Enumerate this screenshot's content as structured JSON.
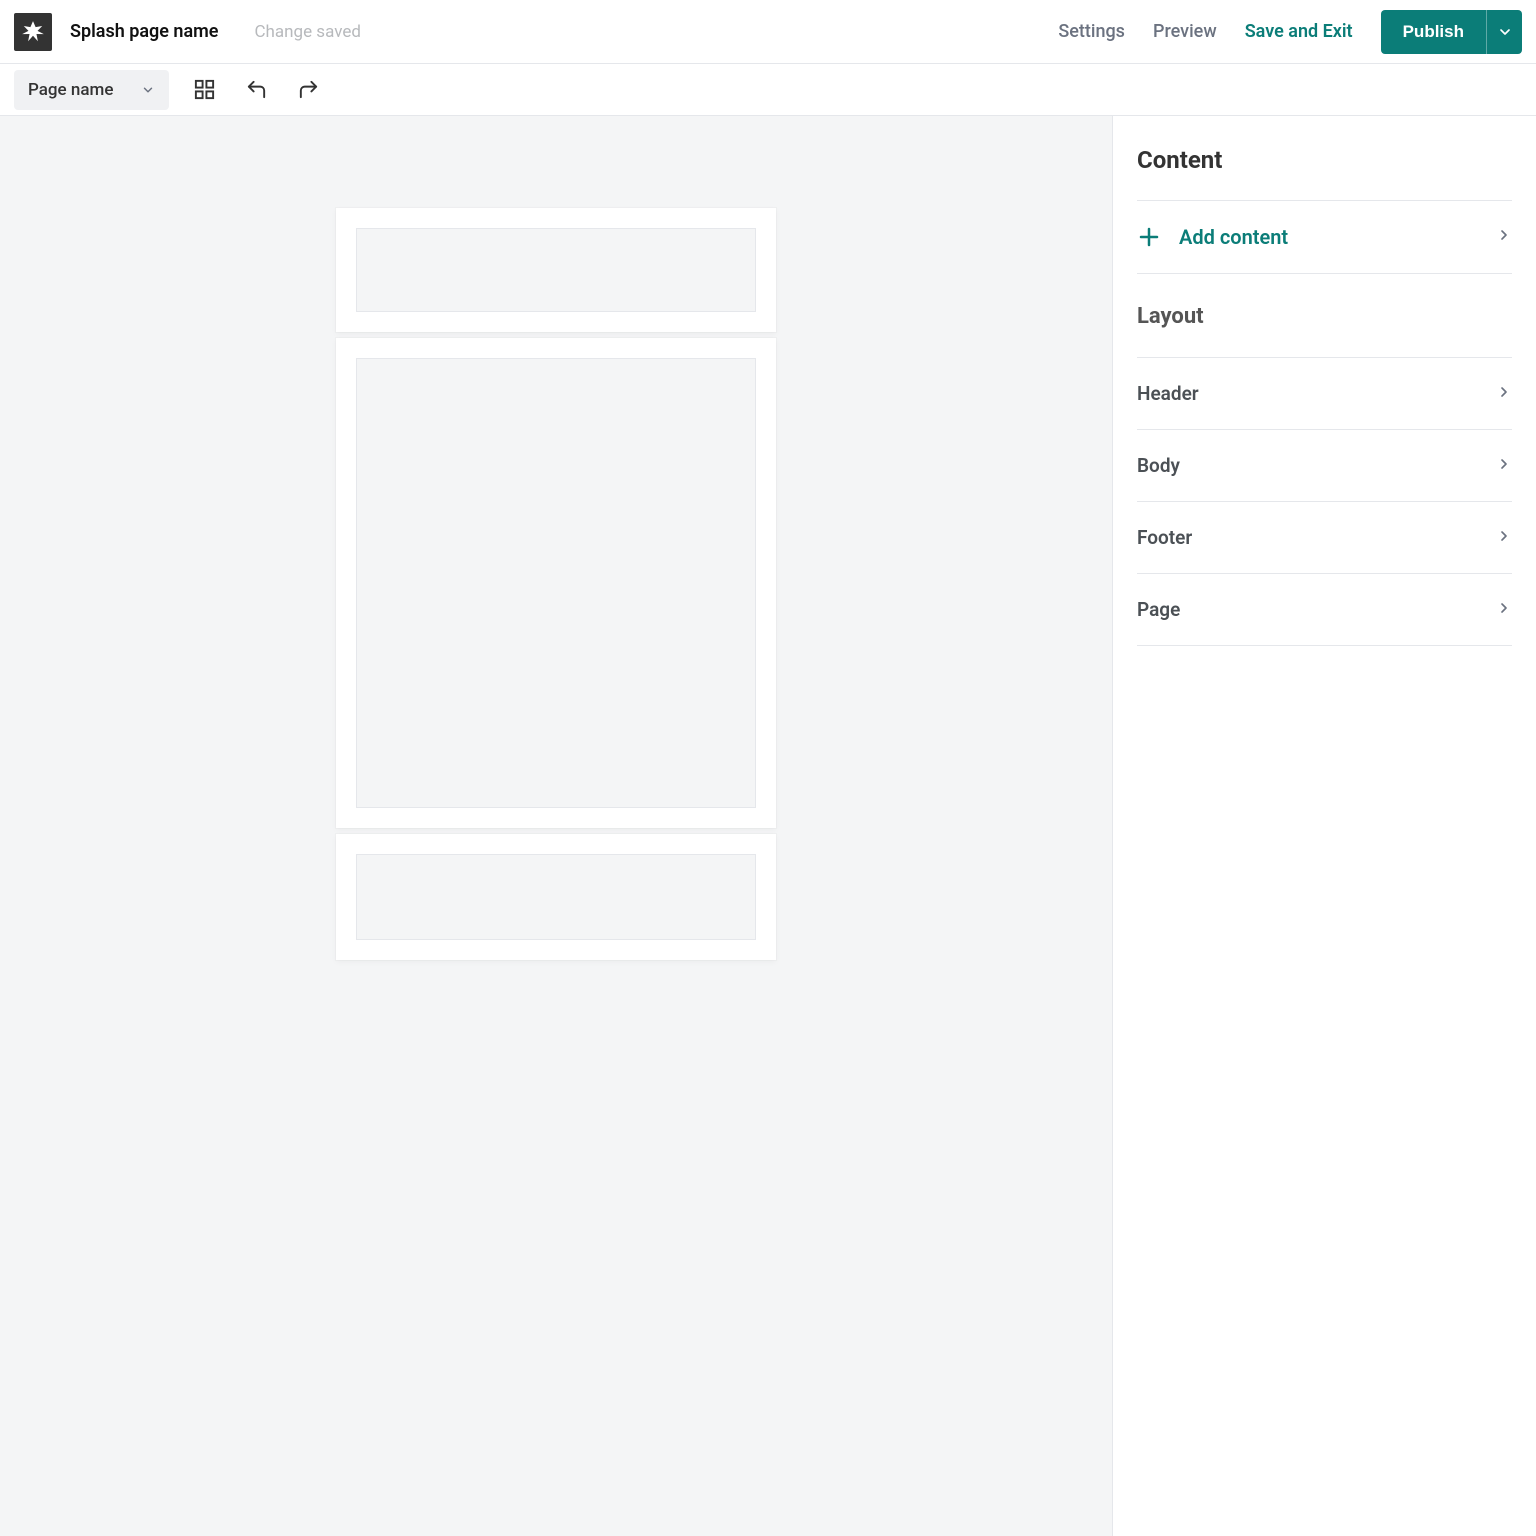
{
  "topbar": {
    "page_title": "Splash page name",
    "status": "Change saved",
    "links": {
      "settings": "Settings",
      "preview": "Preview",
      "save_exit": "Save and Exit"
    },
    "publish_label": "Publish"
  },
  "toolbar": {
    "page_selector_label": "Page name"
  },
  "sidebar": {
    "content_heading": "Content",
    "add_content_label": "Add content",
    "layout_heading": "Layout",
    "layout_items": [
      {
        "label": "Header"
      },
      {
        "label": "Body"
      },
      {
        "label": "Footer"
      },
      {
        "label": "Page"
      }
    ]
  }
}
